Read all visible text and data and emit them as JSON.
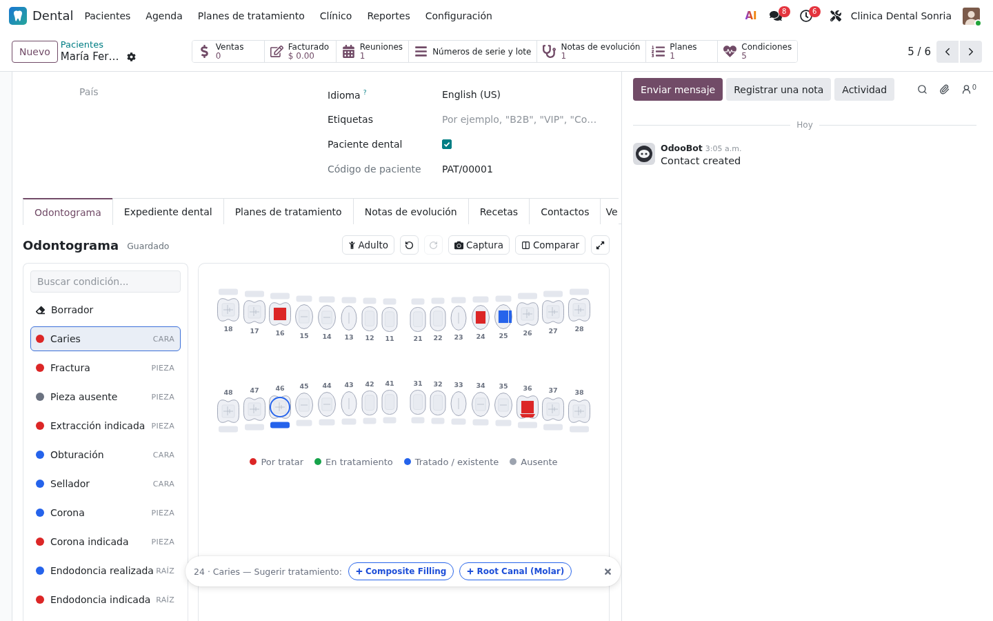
{
  "navbar": {
    "app_name": "Dental",
    "menu": [
      "Pacientes",
      "Agenda",
      "Planes de tratamiento",
      "Clínico",
      "Reportes",
      "Configuración"
    ],
    "ai_label": "AI",
    "messages_badge": "8",
    "activities_badge": "6",
    "company": "Clinica Dental Sonria"
  },
  "control_panel": {
    "new_button": "Nuevo",
    "breadcrumb": "Pacientes",
    "record_name": "María Fer…",
    "smart_buttons": [
      {
        "label": "Ventas",
        "value": "0"
      },
      {
        "label": "Facturado",
        "value": "$ 0.00"
      },
      {
        "label": "Reuniones",
        "value": "1"
      },
      {
        "label": "Números de serie y lote"
      },
      {
        "label": "Notas de evolución",
        "value": "1"
      },
      {
        "label": "Planes",
        "value": "1"
      },
      {
        "label": "Condiciones",
        "value": "5"
      }
    ],
    "pager": "5 / 6"
  },
  "form": {
    "country_field": {
      "placeholder": "País"
    },
    "fields": [
      {
        "label": "Idioma",
        "help": "?",
        "kind": "text",
        "readonly": false,
        "value": "English (US)"
      },
      {
        "label": "Etiquetas",
        "kind": "tags",
        "readonly": false,
        "placeholder": "Por ejemplo, \"B2B\", \"VIP\", \"Co…"
      },
      {
        "label": "Paciente dental",
        "kind": "checkbox",
        "readonly": false,
        "checked": true
      },
      {
        "label": "Código de paciente",
        "kind": "text",
        "readonly": true,
        "value": "PAT/00001"
      }
    ]
  },
  "tabs": [
    {
      "label": "Odontograma",
      "selected": true
    },
    {
      "label": "Expediente dental",
      "selected": false
    },
    {
      "label": "Planes de tratamiento",
      "selected": false
    },
    {
      "label": "Notas de evolución",
      "selected": false
    },
    {
      "label": "Recetas",
      "selected": false
    },
    {
      "label": "Contactos",
      "selected": false
    },
    {
      "label": "Ve",
      "selected": false
    }
  ],
  "odontogram": {
    "title": "Odontograma",
    "save_state": "Guardado",
    "toolbar": {
      "dentition": "Adulto",
      "undo": {
        "disabled": false
      },
      "redo": {
        "disabled": true
      },
      "capture": "Captura",
      "compare": "Comparar"
    },
    "search_placeholder": "Buscar condición...",
    "eraser": {
      "label": "Borrador",
      "selected": false
    },
    "conditions": [
      {
        "name": "Caries",
        "scope": "CARA",
        "color": "#dc2626",
        "selected": true
      },
      {
        "name": "Fractura",
        "scope": "PIEZA",
        "color": "#dc2626",
        "selected": false
      },
      {
        "name": "Pieza ausente",
        "scope": "PIEZA",
        "color": "#6b7280",
        "selected": false
      },
      {
        "name": "Extracción indicada",
        "scope": "PIEZA",
        "color": "#dc2626",
        "selected": false
      },
      {
        "name": "Obturación",
        "scope": "CARA",
        "color": "#2563eb",
        "selected": false
      },
      {
        "name": "Sellador",
        "scope": "CARA",
        "color": "#2563eb",
        "selected": false
      },
      {
        "name": "Corona",
        "scope": "PIEZA",
        "color": "#2563eb",
        "selected": false
      },
      {
        "name": "Corona indicada",
        "scope": "PIEZA",
        "color": "#dc2626",
        "selected": false
      },
      {
        "name": "Endodoncia realizada",
        "scope": "RAÍZ",
        "color": "#2563eb",
        "selected": false
      },
      {
        "name": "Endodoncia indicada",
        "scope": "RAÍZ",
        "color": "#dc2626",
        "selected": false
      }
    ],
    "upper_teeth": [
      {
        "number": "18",
        "kind": "molar"
      },
      {
        "number": "17",
        "kind": "molar"
      },
      {
        "number": "16",
        "kind": "molar",
        "findings": [
          {
            "kind": "center",
            "color": "#dc2626"
          }
        ]
      },
      {
        "number": "15",
        "kind": "premolar"
      },
      {
        "number": "14",
        "kind": "premolar"
      },
      {
        "number": "13",
        "kind": "canine"
      },
      {
        "number": "12",
        "kind": "incisor"
      },
      {
        "number": "11",
        "kind": "incisor"
      },
      {
        "number": "21",
        "kind": "incisor"
      },
      {
        "number": "22",
        "kind": "incisor"
      },
      {
        "number": "23",
        "kind": "canine"
      },
      {
        "number": "24",
        "kind": "premolar",
        "findings": [
          {
            "kind": "center",
            "color": "#dc2626"
          }
        ]
      },
      {
        "number": "25",
        "kind": "premolar",
        "findings": [
          {
            "kind": "center",
            "color": "#2563eb"
          },
          {
            "kind": "right",
            "color": "#2563eb"
          }
        ]
      },
      {
        "number": "26",
        "kind": "molar"
      },
      {
        "number": "27",
        "kind": "molar"
      },
      {
        "number": "28",
        "kind": "molar"
      }
    ],
    "lower_teeth": [
      {
        "number": "48",
        "kind": "molar"
      },
      {
        "number": "47",
        "kind": "molar"
      },
      {
        "number": "46",
        "kind": "molar",
        "findings": [
          {
            "kind": "ring",
            "color": "#2563eb"
          },
          {
            "kind": "root",
            "color": "#2563eb"
          }
        ]
      },
      {
        "number": "45",
        "kind": "premolar"
      },
      {
        "number": "44",
        "kind": "premolar"
      },
      {
        "number": "43",
        "kind": "canine"
      },
      {
        "number": "42",
        "kind": "incisor"
      },
      {
        "number": "41",
        "kind": "incisor"
      },
      {
        "number": "31",
        "kind": "incisor"
      },
      {
        "number": "32",
        "kind": "incisor"
      },
      {
        "number": "33",
        "kind": "canine"
      },
      {
        "number": "34",
        "kind": "premolar"
      },
      {
        "number": "35",
        "kind": "premolar"
      },
      {
        "number": "36",
        "kind": "molar",
        "findings": [
          {
            "kind": "center",
            "color": "#dc2626"
          },
          {
            "kind": "bottom",
            "color": "#dc2626"
          }
        ]
      },
      {
        "number": "37",
        "kind": "molar"
      },
      {
        "number": "38",
        "kind": "molar"
      }
    ],
    "legend": [
      {
        "label": "Por tratar",
        "color": "#dc2626"
      },
      {
        "label": "En tratamiento",
        "color": "#16a34a"
      },
      {
        "label": "Tratado / existente",
        "color": "#2563eb"
      },
      {
        "label": "Ausente",
        "color": "#9ca3af"
      }
    ],
    "suggestion": {
      "text": "24 · Caries — Sugerir tratamiento:",
      "actions": [
        "Composite Filling",
        "Root Canal (Molar)"
      ]
    }
  },
  "chatter": {
    "buttons": [
      {
        "label": "Enviar mensaje",
        "selected": true
      },
      {
        "label": "Registrar una nota",
        "selected": false
      },
      {
        "label": "Actividad",
        "selected": false
      }
    ],
    "followers": "0",
    "date_separator": "Hoy",
    "messages": [
      {
        "author": "OdooBot",
        "time": "3:05 a.m.",
        "body": "Contact created"
      }
    ]
  }
}
